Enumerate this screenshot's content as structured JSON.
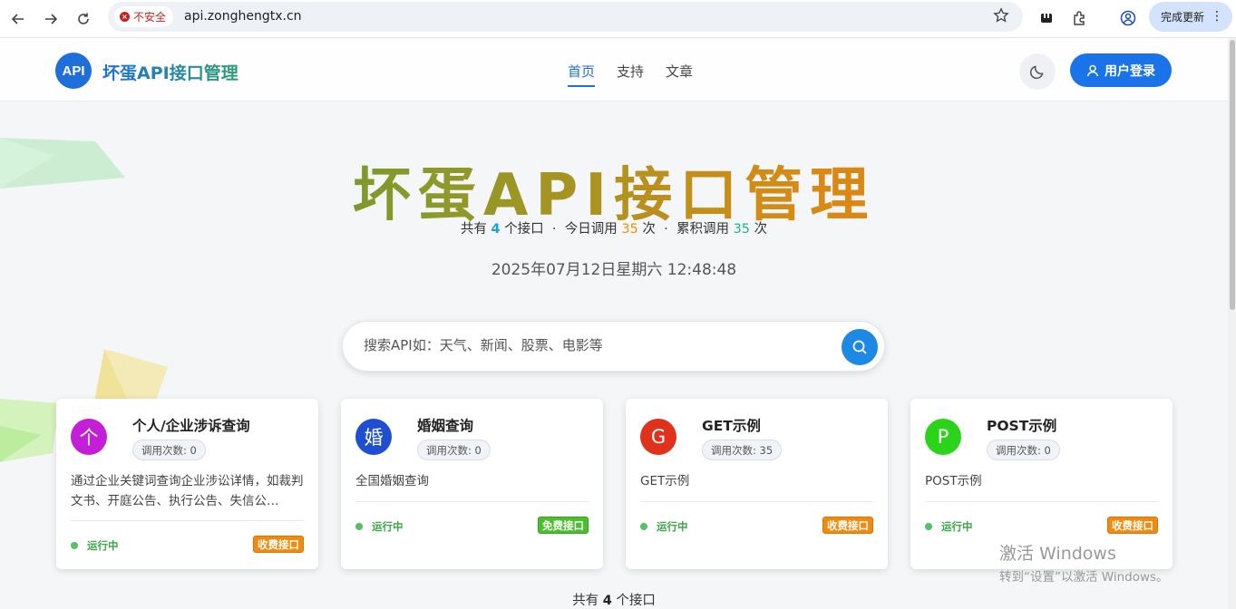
{
  "browser": {
    "insecure_label": "不安全",
    "url": "api.zonghengtx.cn",
    "update_label": "完成更新"
  },
  "header": {
    "logo_text": "API",
    "site_name": "坏蛋API接口管理",
    "nav": [
      "首页",
      "支持",
      "文章"
    ],
    "login_label": "用户登录"
  },
  "hero": {
    "title": "坏蛋API接口管理",
    "stats": {
      "prefix": "共有",
      "api_count": "4",
      "api_suffix": "个接口",
      "today_label": "今日调用",
      "today_count": "35",
      "today_suffix": "次",
      "total_label": "累积调用",
      "total_count": "35",
      "total_suffix": "次"
    },
    "datetime": "2025年07月12日星期六 12:48:48"
  },
  "search": {
    "placeholder": "搜索API如：天气、新闻、股票、电影等"
  },
  "cards": [
    {
      "avatar": "个",
      "color": "#c21fd6",
      "name": "个人/企业涉诉查询",
      "count": "调用次数: 0",
      "desc": "通过企业关键词查询企业涉讼详情，如裁判文书、开庭公告、执行公告、失信公…",
      "status": "运行中",
      "tag": "收费接口"
    },
    {
      "avatar": "婚",
      "color": "#1f4fd0",
      "name": "婚姻查询",
      "count": "调用次数: 0",
      "desc": "全国婚姻查询",
      "status": "运行中",
      "tag": "免费接口"
    },
    {
      "avatar": "G",
      "color": "#e0321a",
      "name": "GET示例",
      "count": "调用次数: 35",
      "desc": "GET示例",
      "status": "运行中",
      "tag": "收费接口"
    },
    {
      "avatar": "P",
      "color": "#2bd41a",
      "name": "POST示例",
      "count": "调用次数: 0",
      "desc": "POST示例",
      "status": "运行中",
      "tag": "收费接口"
    }
  ],
  "footer": {
    "prefix": "共有",
    "count": "4",
    "suffix": "个接口"
  },
  "watermark": {
    "line1": "激活 Windows",
    "line2": "转到“设置”以激活 Windows。"
  }
}
